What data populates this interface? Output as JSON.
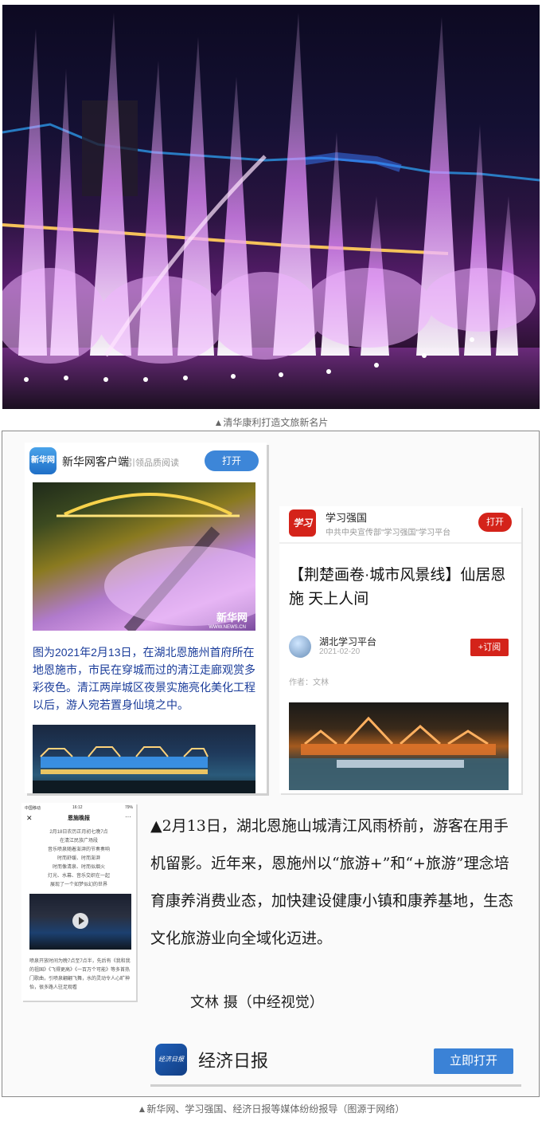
{
  "photo": {
    "caption": "▲清华康利打造文旅新名片"
  },
  "xinhua_card": {
    "logo_text": "新华网",
    "app_name": "新华网客户端",
    "slogan": "引领品质阅读",
    "open_label": "打开",
    "watermark": "新华网",
    "watermark_url": "WWW.NEWS.CN",
    "article_text": "图为2021年2月13日，在湖北恩施州首府所在地恩施市，市民在穿城而过的清江走廊观赏多彩夜色。清江两岸城区夜景实施亮化美化工程以后，游人宛若置身仙境之中。"
  },
  "xuexi_card": {
    "logo_text": "学习",
    "app_name": "学习强国",
    "subtitle": "中共中央宣传部\"学习强国\"学习平台",
    "open_label": "打开",
    "title": "【荆楚画卷·城市风景线】仙居恩施 天上人间",
    "source_name": "湖北学习平台",
    "date": "2021-02-20",
    "subscribe_label": "+订阅",
    "author": "作者：文林"
  },
  "phone_screenshot": {
    "status_left": "中国移动",
    "status_time": "16:12",
    "status_right": "79%",
    "close": "✕",
    "title": "恩施晚报",
    "more": "···",
    "poem": "2月18日农历正月初七晚7点\n在清江民族广场段\n音乐喷泉随着澎湃的节奏奏响\n时而舒缓、时而澎湃\n时而像清泉、时而似烟火\n灯光、水幕、音乐交织在一起\n展现了一个如梦似幻的世界",
    "footer": "喷泉开放时间为晚7点至7点半，先后有《我和我的祖国》《飞得更高》《一百万个可能》等多首热门歌曲，引喷泉翩翩飞舞，水的灵动令人心旷神怡，很多路人驻足观看"
  },
  "jingji_article": {
    "text": "▲2月13日，湖北恩施山城清江风雨桥前，游客在用手机留影。近年来，恩施州以“旅游+”和“+旅游”理念培育康养消费业态，加快建设健康小镇和康养基地，生态文化旅游业向全域化迈进。",
    "credit": "文林 摄（中经视觉）",
    "logo_text": "经济日报",
    "app_name": "经济日报",
    "open_label": "立即打开"
  },
  "collage": {
    "caption": "▲新华网、学习强国、经济日报等媒体纷纷报导（图源于网络）"
  },
  "colors": {
    "xinhua_blue": "#3d86d8",
    "xuexi_red": "#d4231a",
    "jingji_blue": "#3b82d6",
    "xinhua_text": "#1a3c9a"
  }
}
